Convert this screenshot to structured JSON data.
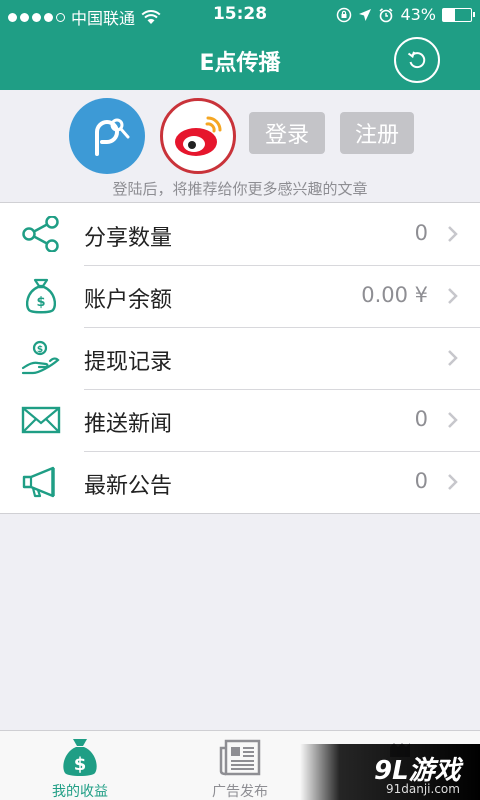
{
  "status_bar": {
    "carrier": "中国联通",
    "time": "15:28",
    "battery_text": "43%",
    "battery_level": 0.43
  },
  "header": {
    "title": "E点传播"
  },
  "login": {
    "login_label": "登录",
    "register_label": "注册",
    "hint": "登陆后，将推荐给你更多感兴趣的文章"
  },
  "menu": {
    "items": [
      {
        "label": "分享数量",
        "value": "0",
        "icon": "share-icon"
      },
      {
        "label": "账户余额",
        "value": "0.00 ¥",
        "icon": "money-bag-icon"
      },
      {
        "label": "提现记录",
        "value": "",
        "icon": "withdraw-icon"
      },
      {
        "label": "推送新闻",
        "value": "0",
        "icon": "envelope-icon"
      },
      {
        "label": "最新公告",
        "value": "0",
        "icon": "megaphone-icon"
      }
    ]
  },
  "tabs": [
    {
      "label": "我的收益",
      "active": true
    },
    {
      "label": "广告发布",
      "active": false
    }
  ],
  "watermark": {
    "logo": "9L游戏",
    "url": "91danji.com"
  },
  "colors": {
    "brand": "#1f9e85",
    "background": "#efeff4",
    "weibo_red": "#c9333a",
    "avatar_blue": "#3d9ad6"
  }
}
